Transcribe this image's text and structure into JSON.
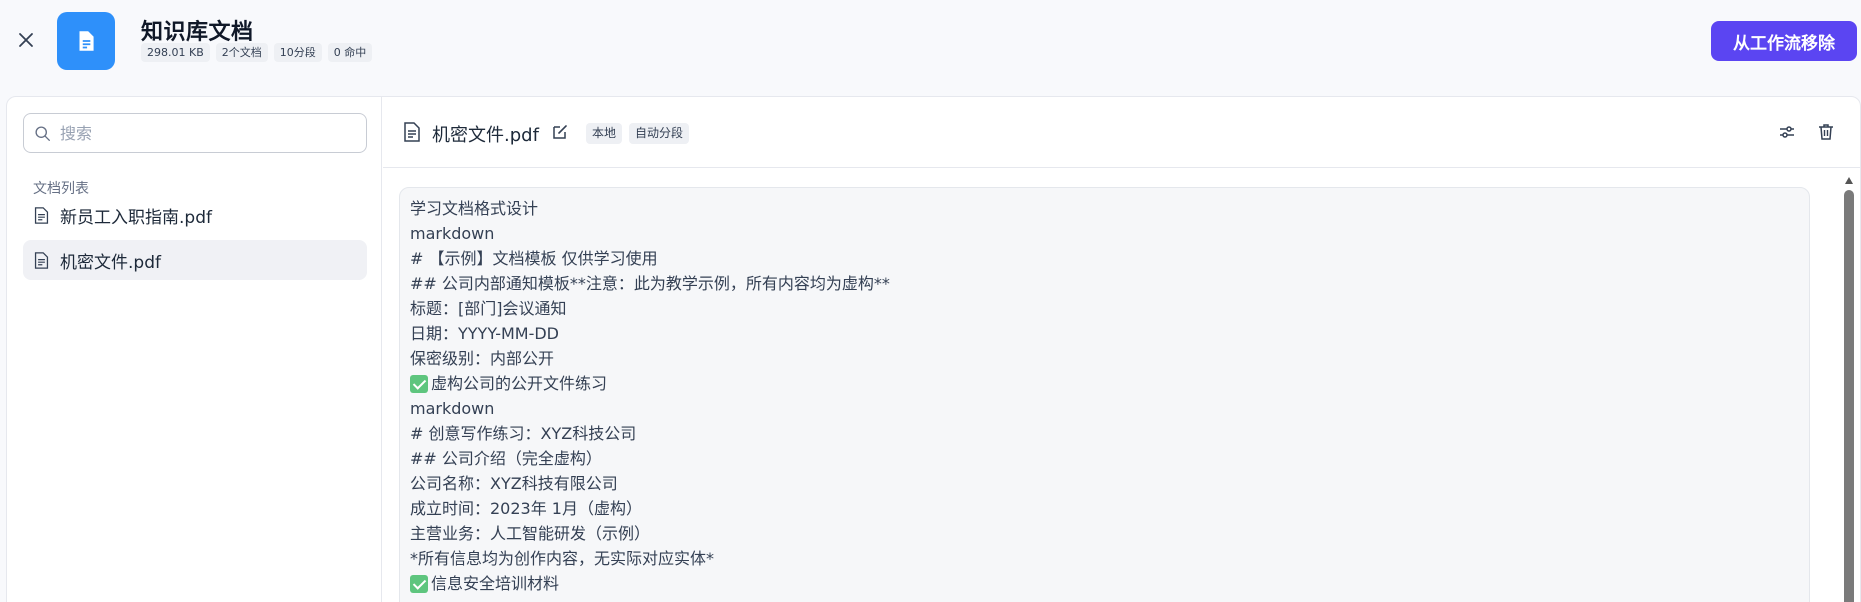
{
  "header": {
    "title": "知识库文档",
    "stats": [
      "298.01 KB",
      "2个文档",
      "10分段",
      "0 命中"
    ],
    "remove_button": "从工作流移除"
  },
  "sidebar": {
    "search_placeholder": "搜索",
    "list_title": "文档列表",
    "files": [
      {
        "name": "新员工入职指南.pdf",
        "active": false
      },
      {
        "name": "机密文件.pdf",
        "active": true
      }
    ]
  },
  "document": {
    "name": "机密文件.pdf",
    "tags": [
      "本地",
      "自动分段"
    ],
    "lines": [
      {
        "text": "学习文档格式设计"
      },
      {
        "text": "markdown"
      },
      {
        "text": "# 【示例】文档模板 仅供学习使用"
      },
      {
        "text": "## 公司内部通知模板**注意：此为教学示例，所有内容均为虚构**"
      },
      {
        "text": "标题：[部门]会议通知"
      },
      {
        "text": "日期：YYYY-MM-DD"
      },
      {
        "text": "保密级别：内部公开"
      },
      {
        "text": "虚构公司的公开文件练习",
        "check": true
      },
      {
        "text": "markdown"
      },
      {
        "text": "# 创意写作练习：XYZ科技公司"
      },
      {
        "text": "## 公司介绍（完全虚构）"
      },
      {
        "text": "公司名称：XYZ科技有限公司"
      },
      {
        "text": "成立时间：2023年 1月（虚构）"
      },
      {
        "text": "主营业务：人工智能研发（示例）"
      },
      {
        "text": "*所有信息均为创作内容，无实际对应实体*"
      },
      {
        "text": "信息安全培训材料",
        "check": true
      }
    ]
  },
  "colors": {
    "accent": "#5b45f2",
    "doc_badge": "#2e90fa",
    "check": "#5ec57e"
  },
  "icons": {
    "close": "close-icon",
    "doc_badge": "document-icon",
    "search": "search-icon",
    "file": "file-icon",
    "edit": "edit-icon",
    "settings": "settings-sliders-icon",
    "delete": "trash-icon"
  }
}
